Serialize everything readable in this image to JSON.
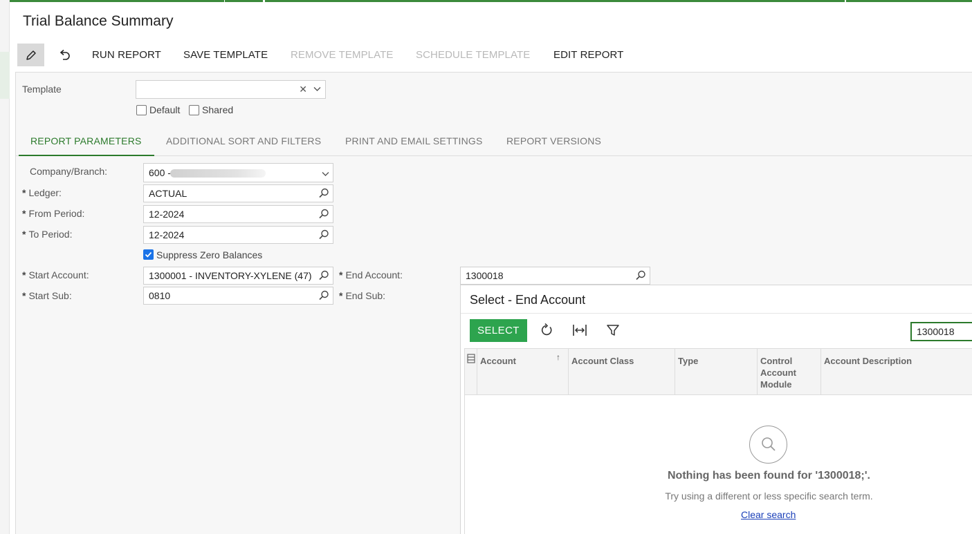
{
  "page": {
    "title": "Trial Balance Summary"
  },
  "toolbar": {
    "run_report": "RUN REPORT",
    "save_template": "SAVE TEMPLATE",
    "remove_template": "REMOVE TEMPLATE",
    "schedule_template": "SCHEDULE TEMPLATE",
    "edit_report": "EDIT REPORT",
    "icons": {
      "edit": "pencil-icon",
      "undo": "undo-icon"
    }
  },
  "template": {
    "label": "Template",
    "value": "",
    "default_label": "Default",
    "default_checked": false,
    "shared_label": "Shared",
    "shared_checked": false
  },
  "tabs": [
    {
      "label": "REPORT PARAMETERS",
      "active": true
    },
    {
      "label": "ADDITIONAL SORT AND FILTERS",
      "active": false
    },
    {
      "label": "PRINT AND EMAIL SETTINGS",
      "active": false
    },
    {
      "label": "REPORT VERSIONS",
      "active": false
    }
  ],
  "params": {
    "company_branch": {
      "label": "Company/Branch:",
      "value": "600 -"
    },
    "ledger": {
      "label": "Ledger:",
      "value": "ACTUAL",
      "required": true
    },
    "from_period": {
      "label": "From Period:",
      "value": "12-2024",
      "required": true
    },
    "to_period": {
      "label": "To Period:",
      "value": "12-2024",
      "required": true
    },
    "suppress_zero": {
      "label": "Suppress Zero Balances",
      "checked": true
    },
    "start_account": {
      "label": "Start Account:",
      "value": "1300001 - INVENTORY-XYLENE (47)",
      "required": true
    },
    "start_sub": {
      "label": "Start Sub:",
      "value": "0810",
      "required": true
    },
    "end_account": {
      "label": "End Account:",
      "value": "1300018",
      "required": true
    },
    "end_sub": {
      "label": "End Sub:",
      "value": "",
      "required": true
    },
    "required_mark": "*"
  },
  "dialog": {
    "title": "Select - End Account",
    "select_label": "SELECT",
    "search_value": "1300018",
    "icons": {
      "refresh": "refresh-icon",
      "fit": "fit-columns-icon",
      "filter": "filter-icon"
    },
    "columns": [
      {
        "label": "Account",
        "sort": "asc"
      },
      {
        "label": "Account Class"
      },
      {
        "label": "Type"
      },
      {
        "label": "Control Account Module"
      },
      {
        "label": "Account Description"
      }
    ],
    "empty": {
      "title": "Nothing has been found for '1300018;'.",
      "subtitle": "Try using a different or less specific search term.",
      "clear_link": "Clear search"
    }
  },
  "colors": {
    "accent_green": "#2b7a2b",
    "select_button": "#2da44e",
    "checkbox_blue": "#1a73e8",
    "link": "#1a3fb8"
  }
}
